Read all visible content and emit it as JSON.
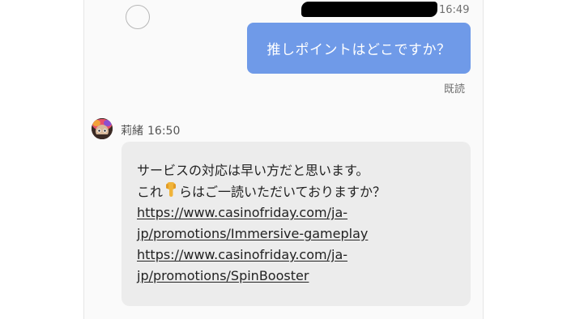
{
  "header": {
    "time": "16:49"
  },
  "outgoing": {
    "text": "推しポイントはどこですか？",
    "read_status": "既読",
    "bubble_color": "#6f9ae8"
  },
  "incoming": {
    "sender_name": "莉緒",
    "time": "16:50",
    "line1": "サービスの対応は早い方だと思います。",
    "line2_before": "これ",
    "line2_icon": "pointing-down-hand-icon",
    "line2_after": "らはご一読いただいておりますか？",
    "links": [
      {
        "line_a": "https://www.casinofriday.com/ja-",
        "line_b": "jp/promotions/Immersive-gameplay"
      },
      {
        "line_a": "https://www.casinofriday.com/ja-",
        "line_b": "jp/promotions/SpinBooster"
      }
    ],
    "bubble_color": "#ececec"
  }
}
